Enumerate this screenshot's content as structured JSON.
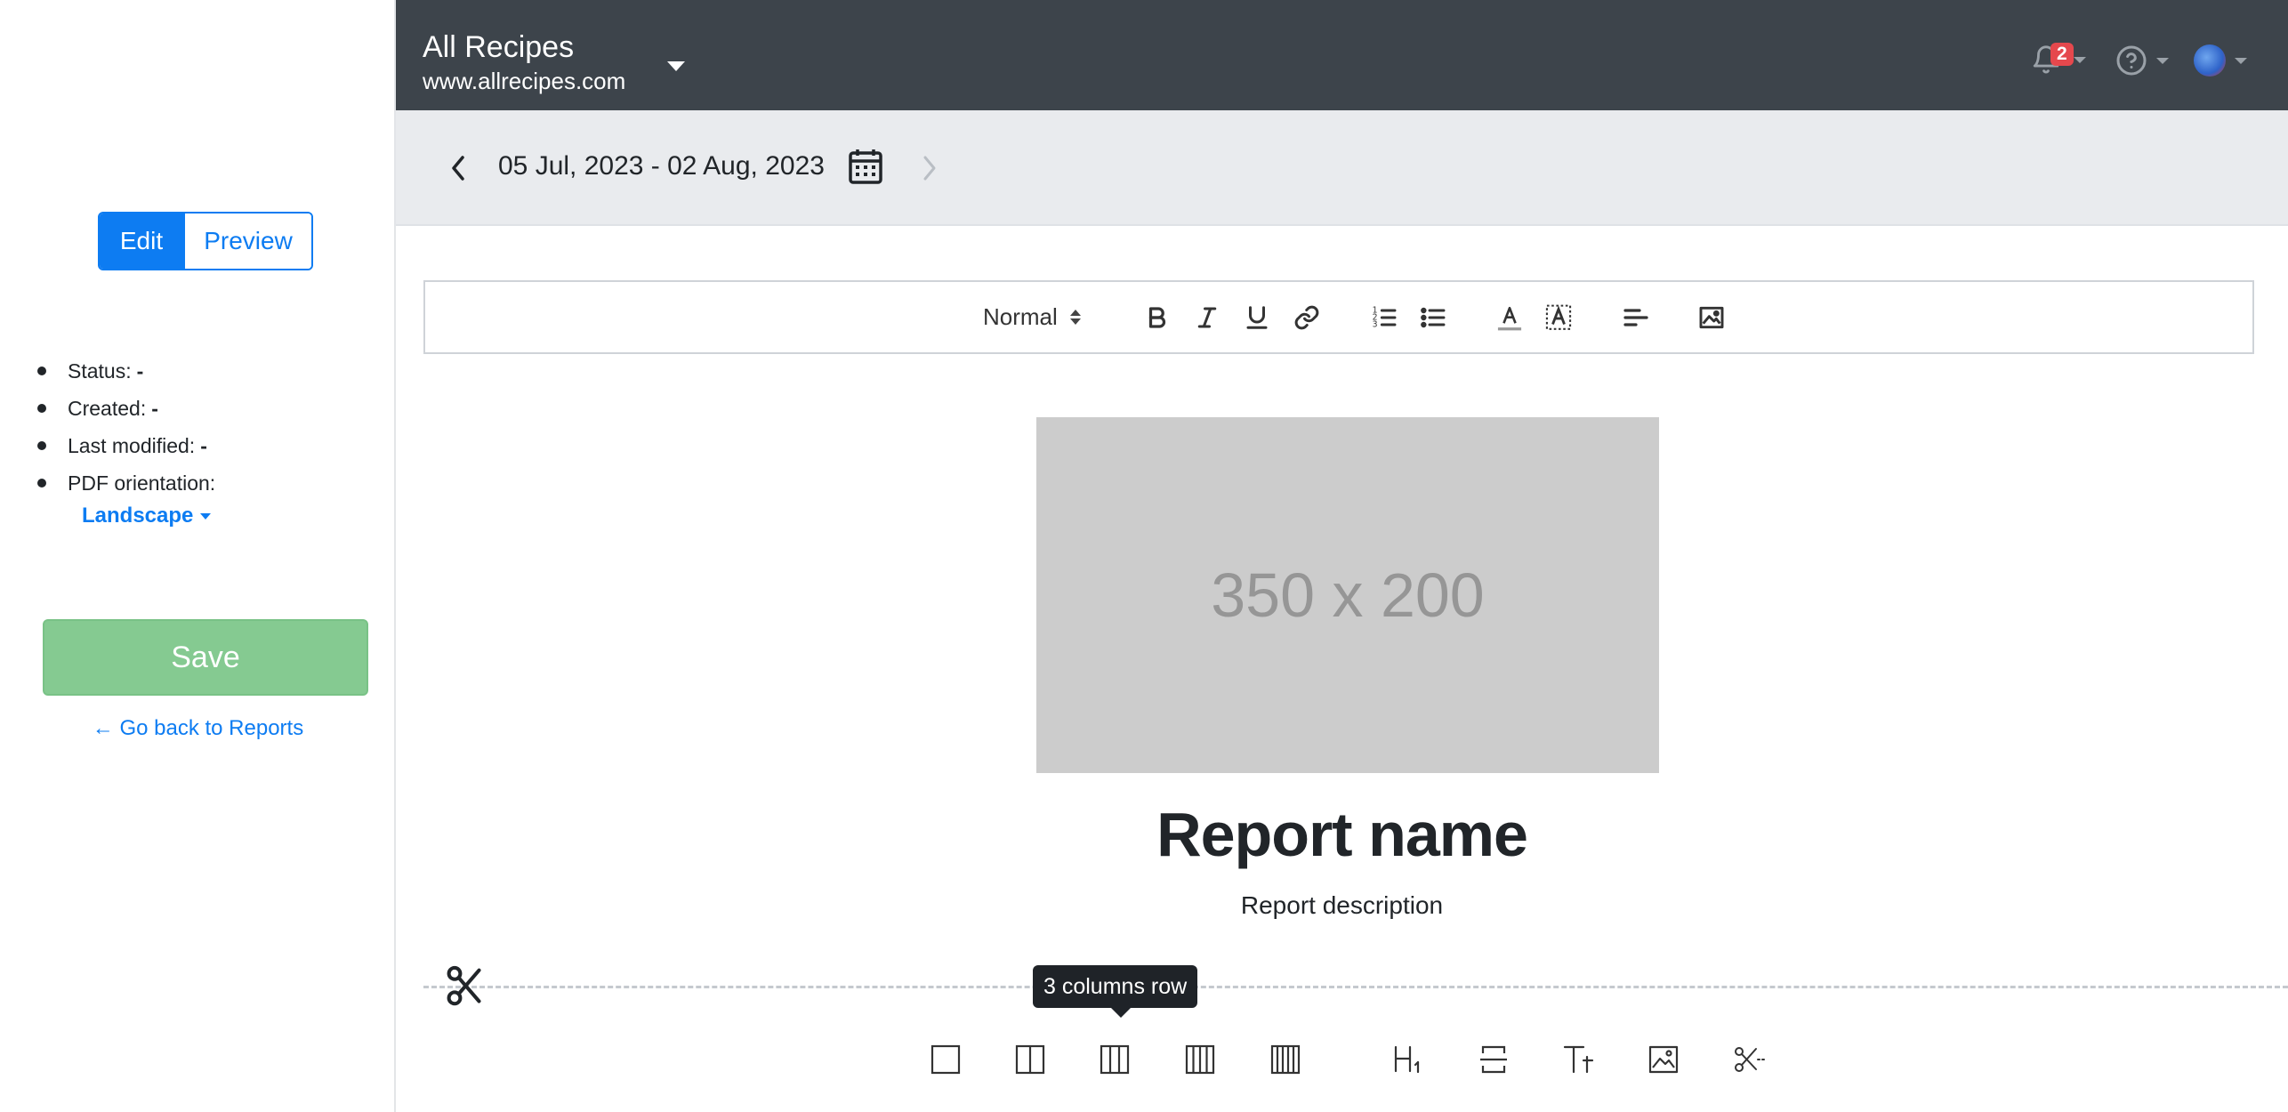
{
  "sidebar": {
    "edit_label": "Edit",
    "preview_label": "Preview",
    "meta": [
      {
        "label": "Status:",
        "value": "-"
      },
      {
        "label": "Created:",
        "value": "-"
      },
      {
        "label": "Last modified:",
        "value": "-"
      },
      {
        "label": "PDF orientation:",
        "value": ""
      }
    ],
    "orientation": "Landscape",
    "save_label": "Save",
    "back_label": "← Go back to Reports"
  },
  "header": {
    "site_title": "All Recipes",
    "site_url": "www.allrecipes.com",
    "notification_count": "2"
  },
  "datebar": {
    "range": "05 Jul, 2023 - 02 Aug, 2023"
  },
  "toolbar": {
    "format_label": "Normal"
  },
  "content": {
    "placeholder_text": "350 x 200",
    "report_name": "Report name",
    "report_description": "Report description"
  },
  "tooltip": {
    "text": "3 columns row"
  },
  "icons": {
    "toolbar": [
      "bold-icon",
      "italic-icon",
      "underline-icon",
      "link-icon",
      "ordered-list-icon",
      "bullet-list-icon",
      "text-color-icon",
      "background-color-icon",
      "align-left-icon",
      "image-icon"
    ],
    "blocks": [
      "one-column-row-icon",
      "two-columns-row-icon",
      "three-columns-row-icon",
      "four-columns-row-icon",
      "five-columns-row-icon",
      "heading-icon",
      "divider-icon",
      "text-icon",
      "image-block-icon",
      "page-break-icon"
    ]
  },
  "colors": {
    "accent": "#0d7cf2",
    "topbar": "#3d444b",
    "save": "#85ca91",
    "badge": "#e5484d"
  }
}
